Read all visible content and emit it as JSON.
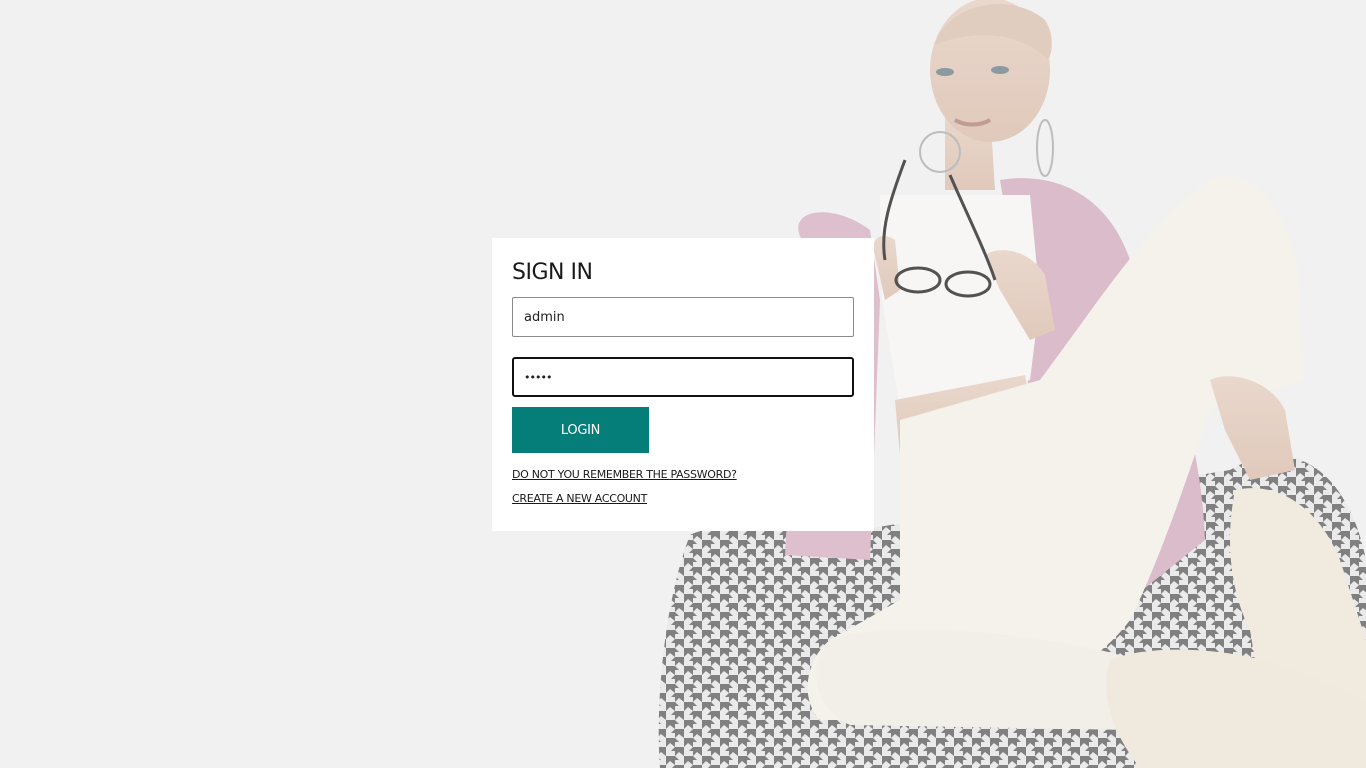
{
  "login": {
    "title": "SIGN IN",
    "username_value": "admin",
    "password_value": "•••••",
    "login_label": "LOGIN",
    "forgot_password_label": "DO NOT YOU REMEMBER THE PASSWORD?",
    "create_account_label": "CREATE A NEW ACCOUNT"
  },
  "colors": {
    "background": "#efefef",
    "accent": "#057d79",
    "card": "#ffffff"
  },
  "background_image": {
    "icon": "model-photo"
  }
}
